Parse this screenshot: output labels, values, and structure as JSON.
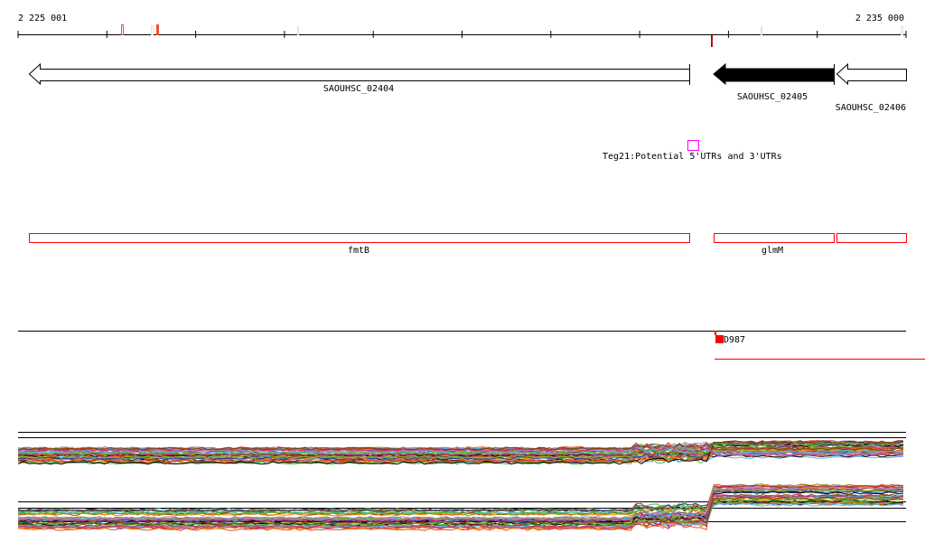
{
  "ruler": {
    "start_label": "2 225 001",
    "end_label": "2 235 000"
  },
  "genes": [
    {
      "label": "SAOUHSC_02404",
      "strand": "-",
      "fill": "#ffffff"
    },
    {
      "label": "SAOUHSC_02405",
      "strand": "-",
      "fill": "#000000"
    },
    {
      "label": "SAOUHSC_02406",
      "strand": "-",
      "fill": "#ffffff"
    }
  ],
  "utr_feature": {
    "label": "Teg21:Potential 5'UTRs and 3'UTRs",
    "color": "#ff00ff"
  },
  "annotations": [
    {
      "label": "fmtB"
    },
    {
      "label": "glmM"
    },
    {
      "label": ""
    }
  ],
  "annotation_color": "#ff0000",
  "variant": {
    "label": "D987",
    "color": "#ff0000"
  }
}
